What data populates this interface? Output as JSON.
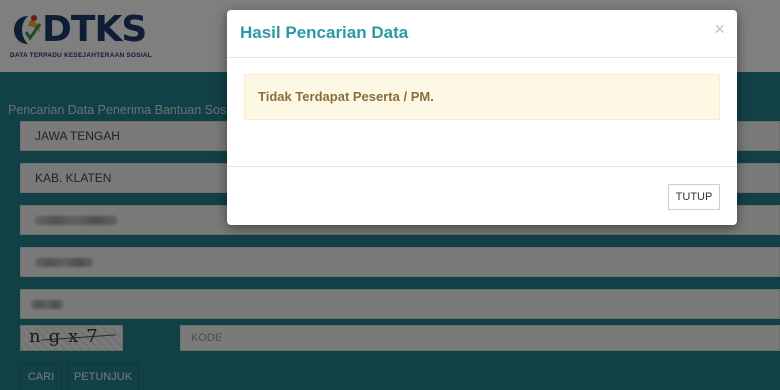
{
  "header": {
    "logo_text": "DTKS",
    "logo_subtitle": "DATA TERPADU KESEJAHTERAAN SOSIAL"
  },
  "form": {
    "section_title": "Pencarian Data Penerima Bantuan Sosial",
    "province_value": "JAWA TENGAH",
    "regency_value": "KAB. KLATEN",
    "captcha_text": "ngx7",
    "code_placeholder": "KODE",
    "search_button": "CARI",
    "guide_button": "PETUNJUK"
  },
  "modal": {
    "title": "Hasil Pencarian Data",
    "close_symbol": "×",
    "message": "Tidak Terdapat Peserta / PM.",
    "close_button": "TUTUP"
  },
  "colors": {
    "teal_band": "#23838f",
    "modal_title": "#2b9aa6",
    "alert_bg": "#fcf8e3",
    "alert_text": "#8a6d3b",
    "logo_navy": "#1f3b6e"
  }
}
